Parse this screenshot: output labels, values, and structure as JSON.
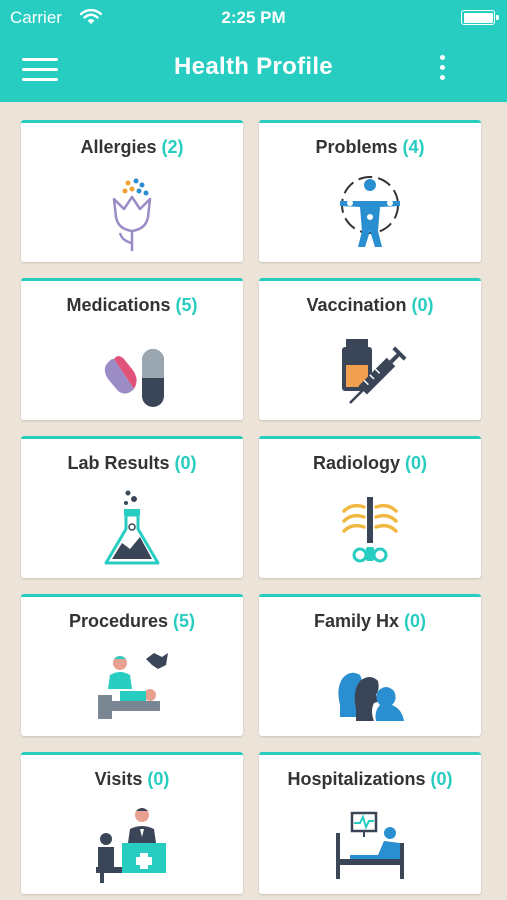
{
  "status_bar": {
    "carrier": "Carrier",
    "time": "2:25 PM"
  },
  "header": {
    "title": "Health Profile",
    "menu_icon": "hamburger-menu-icon",
    "more_icon": "more-vertical-icon"
  },
  "accent_color": "#27cdc0",
  "cards": [
    {
      "label": "Allergies",
      "count": "(2)",
      "icon": "flower-pollen-icon"
    },
    {
      "label": "Problems",
      "count": "(4)",
      "icon": "body-joints-icon"
    },
    {
      "label": "Medications",
      "count": "(5)",
      "icon": "pills-icon"
    },
    {
      "label": "Vaccination",
      "count": "(0)",
      "icon": "vial-syringe-icon"
    },
    {
      "label": "Lab Results",
      "count": "(0)",
      "icon": "flask-icon"
    },
    {
      "label": "Radiology",
      "count": "(0)",
      "icon": "ribcage-xray-icon"
    },
    {
      "label": "Procedures",
      "count": "(5)",
      "icon": "surgeon-patient-icon"
    },
    {
      "label": "Family Hx",
      "count": "(0)",
      "icon": "family-profiles-icon"
    },
    {
      "label": "Visits",
      "count": "(0)",
      "icon": "doctor-desk-icon"
    },
    {
      "label": "Hospitalizations",
      "count": "(0)",
      "icon": "hospital-bed-icon"
    }
  ]
}
